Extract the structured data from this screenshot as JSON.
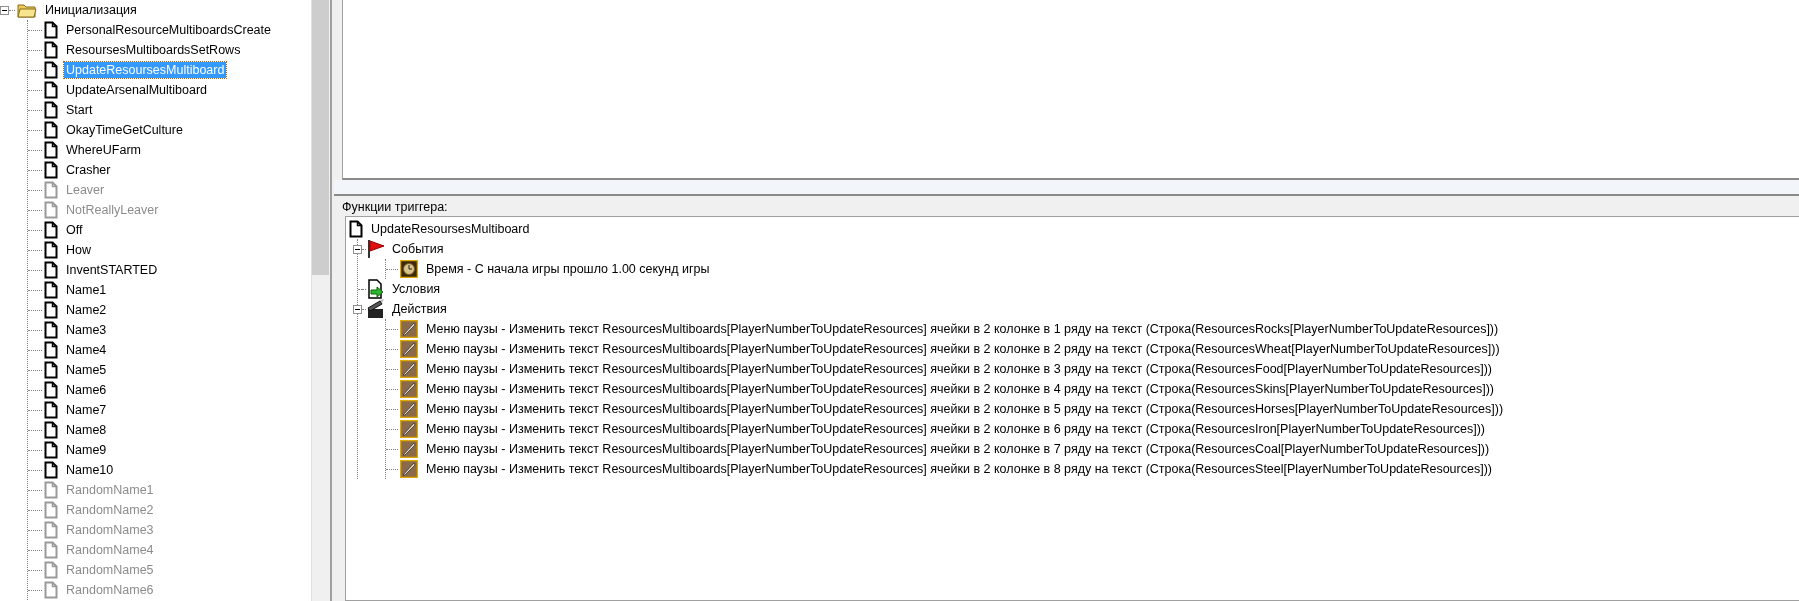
{
  "trigger_list": {
    "folder": {
      "label": "Инициализация",
      "expanded": true,
      "children": [
        {
          "label": "PersonalResourceMultiboardsCreate",
          "enabled": true,
          "selected": false
        },
        {
          "label": "ResoursesMultiboardsSetRows",
          "enabled": true,
          "selected": false
        },
        {
          "label": "UpdateResoursesMultiboard",
          "enabled": true,
          "selected": true
        },
        {
          "label": "UpdateArsenalMultiboard",
          "enabled": true,
          "selected": false
        },
        {
          "label": "Start",
          "enabled": true,
          "selected": false
        },
        {
          "label": "OkayTimeGetCulture",
          "enabled": true,
          "selected": false
        },
        {
          "label": "WhereUFarm",
          "enabled": true,
          "selected": false
        },
        {
          "label": "Crasher",
          "enabled": true,
          "selected": false
        },
        {
          "label": "Leaver",
          "enabled": false,
          "selected": false
        },
        {
          "label": "NotReallyLeaver",
          "enabled": false,
          "selected": false
        },
        {
          "label": "Off",
          "enabled": true,
          "selected": false
        },
        {
          "label": "How",
          "enabled": true,
          "selected": false
        },
        {
          "label": "InventSTARTED",
          "enabled": true,
          "selected": false
        },
        {
          "label": "Name1",
          "enabled": true,
          "selected": false
        },
        {
          "label": "Name2",
          "enabled": true,
          "selected": false
        },
        {
          "label": "Name3",
          "enabled": true,
          "selected": false
        },
        {
          "label": "Name4",
          "enabled": true,
          "selected": false
        },
        {
          "label": "Name5",
          "enabled": true,
          "selected": false
        },
        {
          "label": "Name6",
          "enabled": true,
          "selected": false
        },
        {
          "label": "Name7",
          "enabled": true,
          "selected": false
        },
        {
          "label": "Name8",
          "enabled": true,
          "selected": false
        },
        {
          "label": "Name9",
          "enabled": true,
          "selected": false
        },
        {
          "label": "Name10",
          "enabled": true,
          "selected": false
        },
        {
          "label": "RandomName1",
          "enabled": false,
          "selected": false
        },
        {
          "label": "RandomName2",
          "enabled": false,
          "selected": false
        },
        {
          "label": "RandomName3",
          "enabled": false,
          "selected": false
        },
        {
          "label": "RandomName4",
          "enabled": false,
          "selected": false
        },
        {
          "label": "RandomName5",
          "enabled": false,
          "selected": false
        },
        {
          "label": "RandomName6",
          "enabled": false,
          "selected": false
        }
      ]
    }
  },
  "functions_panel": {
    "title": "Функции триггера:",
    "root": {
      "label": "UpdateResoursesMultiboard",
      "children": [
        {
          "kind": "events",
          "label": "События",
          "expanded": true,
          "children": [
            {
              "kind": "time",
              "label": "Время - С начала игры прошло 1.00 секунд игры"
            }
          ]
        },
        {
          "kind": "conditions",
          "label": "Условия"
        },
        {
          "kind": "actions",
          "label": "Действия",
          "expanded": true,
          "children": [
            {
              "kind": "action",
              "label": "Меню паузы - Изменить текст ResourcesMultiboards[PlayerNumberToUpdateResources] ячейки в 2 колонке в 1 ряду на текст (Строка(ResourcesRocks[PlayerNumberToUpdateResources]))"
            },
            {
              "kind": "action",
              "label": "Меню паузы - Изменить текст ResourcesMultiboards[PlayerNumberToUpdateResources] ячейки в 2 колонке в 2 ряду на текст (Строка(ResourcesWheat[PlayerNumberToUpdateResources]))"
            },
            {
              "kind": "action",
              "label": "Меню паузы - Изменить текст ResourcesMultiboards[PlayerNumberToUpdateResources] ячейки в 2 колонке в 3 ряду на текст (Строка(ResourcesFood[PlayerNumberToUpdateResources]))"
            },
            {
              "kind": "action",
              "label": "Меню паузы - Изменить текст ResourcesMultiboards[PlayerNumberToUpdateResources] ячейки в 2 колонке в 4 ряду на текст (Строка(ResourcesSkins[PlayerNumberToUpdateResources]))"
            },
            {
              "kind": "action",
              "label": "Меню паузы - Изменить текст ResourcesMultiboards[PlayerNumberToUpdateResources] ячейки в 2 колонке в 5 ряду на текст (Строка(ResourcesHorses[PlayerNumberToUpdateResources]))"
            },
            {
              "kind": "action",
              "label": "Меню паузы - Изменить текст ResourcesMultiboards[PlayerNumberToUpdateResources] ячейки в 2 колонке в 6 ряду на текст (Строка(ResourcesIron[PlayerNumberToUpdateResources]))"
            },
            {
              "kind": "action",
              "label": "Меню паузы - Изменить текст ResourcesMultiboards[PlayerNumberToUpdateResources] ячейки в 2 колонке в 7 ряду на текст (Строка(ResourcesCoal[PlayerNumberToUpdateResources]))"
            },
            {
              "kind": "action",
              "label": "Меню паузы - Изменить текст ResourcesMultiboards[PlayerNumberToUpdateResources] ячейки в 2 колонке в 8 ряду на текст (Строка(ResourcesSteel[PlayerNumberToUpdateResources]))"
            }
          ]
        }
      ]
    }
  }
}
